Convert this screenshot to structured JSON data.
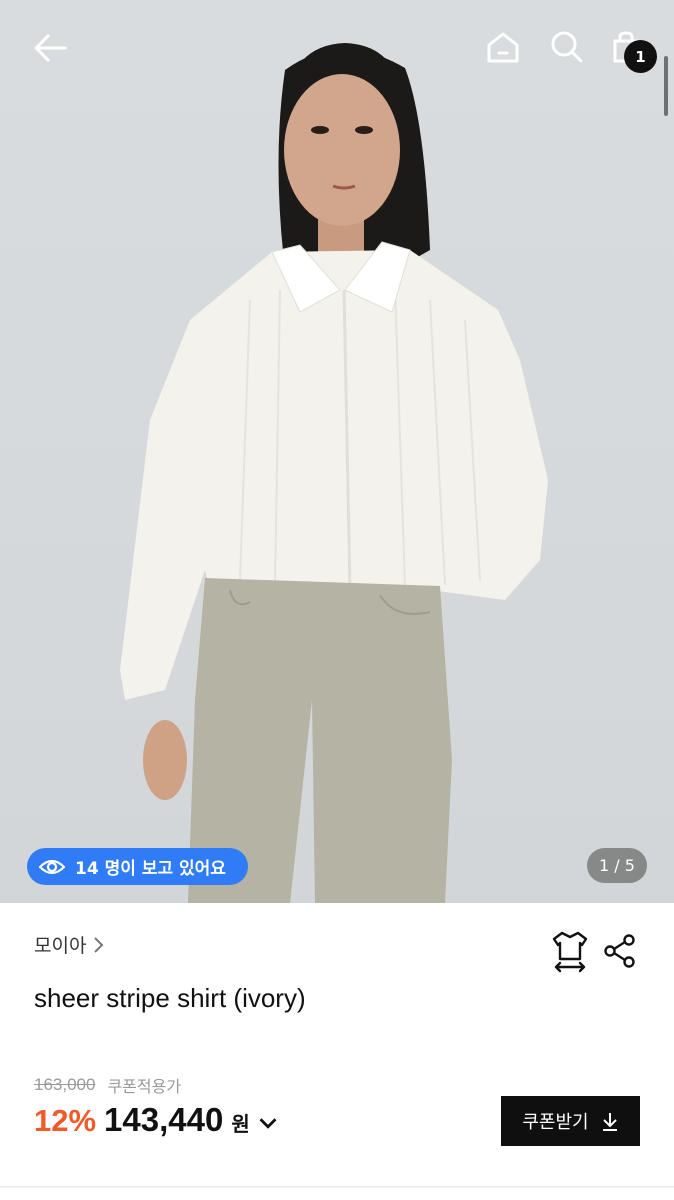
{
  "header": {
    "cart_count": "1"
  },
  "gallery": {
    "viewers_text": "14 명이 보고 있어요",
    "page_indicator": "1 / 5"
  },
  "product": {
    "brand": "모이아",
    "title": "sheer stripe shirt (ivory)",
    "original_price": "163,000",
    "coupon_price_label": "쿠폰적용가",
    "discount_rate": "12%",
    "price": "143,440",
    "currency": "원",
    "coupon_button_label": "쿠폰받기"
  },
  "colors": {
    "accent_blue": "#2f7cf6",
    "discount_orange": "#f05a28",
    "button_black": "#0f0f0f"
  },
  "icons": [
    "back-arrow-icon",
    "home-icon",
    "search-icon",
    "shopping-bag-icon",
    "eye-icon",
    "size-guide-icon",
    "share-icon",
    "chevron-right-icon",
    "chevron-down-icon",
    "download-icon"
  ]
}
